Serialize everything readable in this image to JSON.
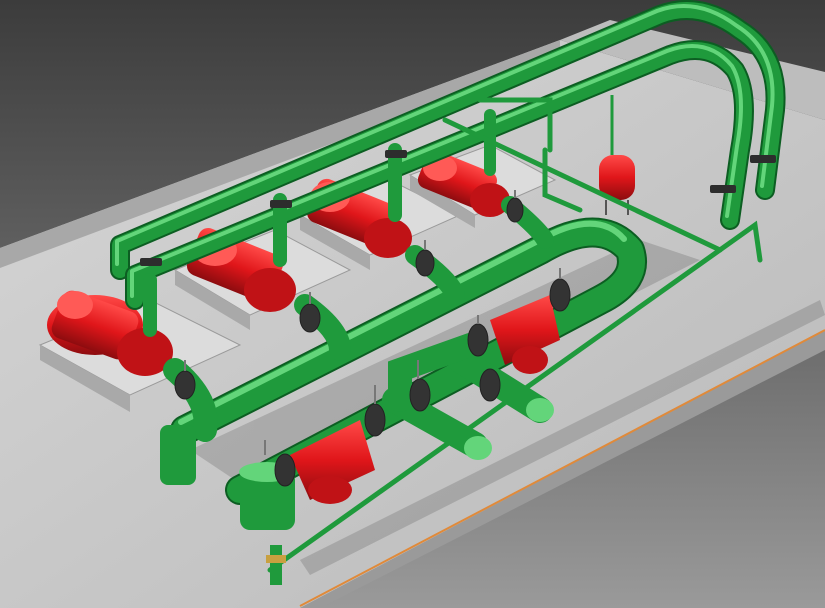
{
  "scene": {
    "subject": "pump-station-3d-render",
    "colors": {
      "background_top": "#3f3f3f",
      "background_bottom": "#8a8a8a",
      "slab": "#c9c9c9",
      "slab_side": "#9e9e9e",
      "pipe": "#1f9a3c",
      "pipe_highlight": "#63d57a",
      "pipe_shadow": "#0c5e22",
      "pump": "#e0161a",
      "pump_shadow": "#8d0c0f",
      "edge_glow": "#e08a3a"
    },
    "pumps": [
      "pump-1",
      "pump-2",
      "pump-3",
      "pump-4"
    ],
    "valves": [
      "valve-1",
      "valve-2",
      "valve-3",
      "valve-4",
      "valve-5",
      "valve-6",
      "valve-7",
      "valve-8",
      "valve-9",
      "valve-10"
    ]
  }
}
